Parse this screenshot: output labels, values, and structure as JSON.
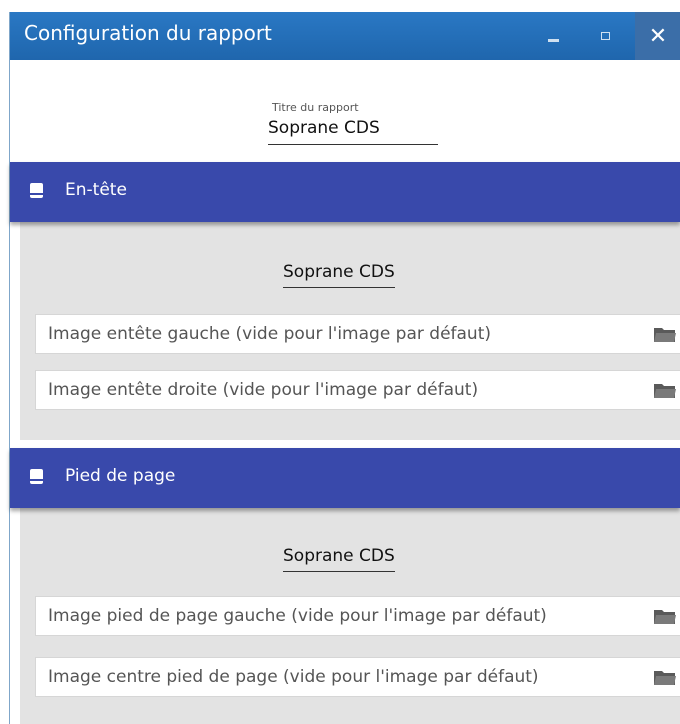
{
  "window": {
    "title": "Configuration du rapport",
    "close_glyph": "✕"
  },
  "report_title": {
    "label": "Titre du rapport",
    "value": "Soprane CDS"
  },
  "header_section": {
    "icon": "document-icon",
    "label": "En-tête",
    "text_value": "Soprane CDS",
    "fields": [
      {
        "placeholder": "Image entête gauche (vide pour l'image par défaut)",
        "icon": "folder-icon"
      },
      {
        "placeholder": "Image entête droite (vide pour l'image par défaut)",
        "icon": "folder-icon"
      }
    ]
  },
  "footer_section": {
    "icon": "document-icon",
    "label": "Pied de page",
    "text_value": "Soprane CDS",
    "fields": [
      {
        "placeholder": "Image pied de page gauche (vide pour l'image par défaut)",
        "icon": "folder-icon"
      },
      {
        "placeholder": "Image centre pied de page (vide pour l'image par défaut)",
        "icon": "folder-icon"
      }
    ]
  },
  "colors": {
    "titlebar": "#1f66ad",
    "section_header": "#3949ab",
    "section_body": "#e3e3e3"
  }
}
